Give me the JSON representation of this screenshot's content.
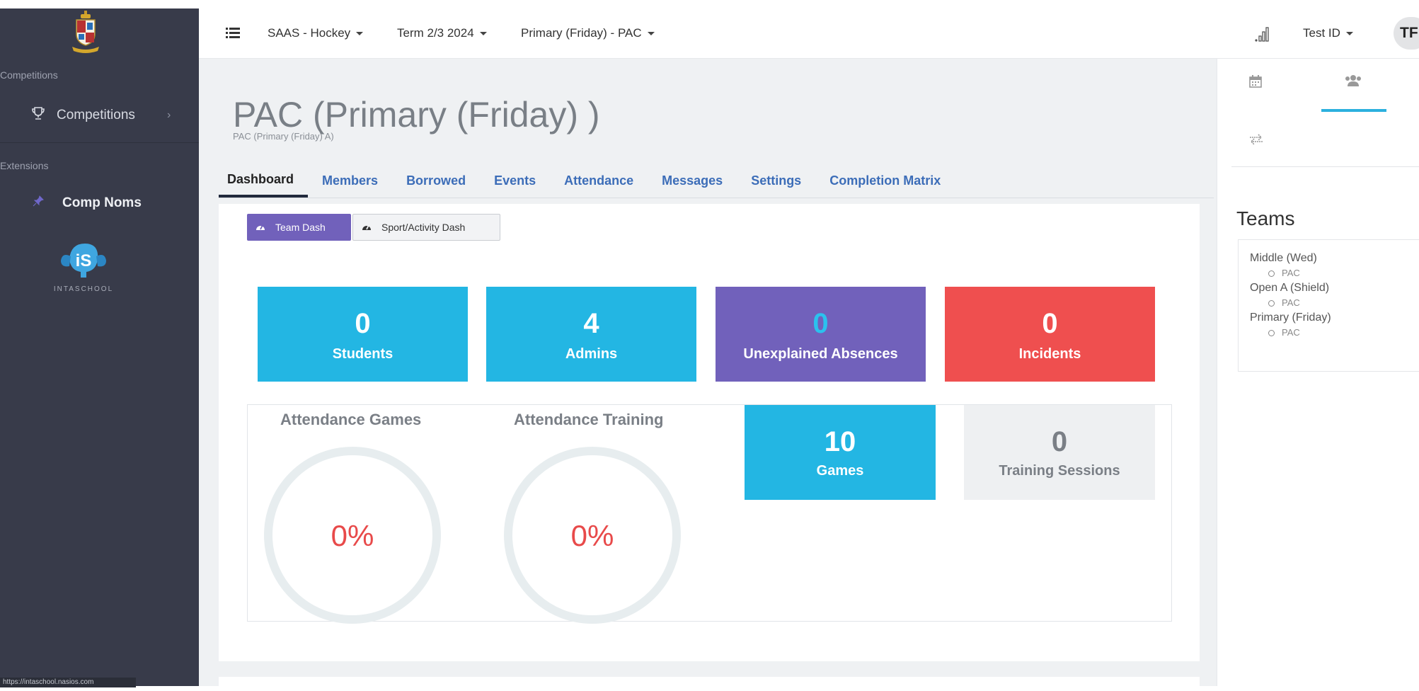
{
  "sidebar": {
    "sections": [
      {
        "label": "Competitions",
        "items": [
          {
            "label": "Competitions",
            "icon": "trophy-icon"
          }
        ]
      },
      {
        "label": "Extensions",
        "items": [
          {
            "label": "Comp Noms",
            "icon": "pin-icon"
          }
        ]
      }
    ],
    "logo_text": "INTASCHOOL",
    "status_url": "https://intaschool.nasios.com"
  },
  "topbar": {
    "nav": [
      {
        "label": "SAAS - Hockey"
      },
      {
        "label": "Term 2/3 2024"
      },
      {
        "label": "Primary (Friday) - PAC"
      }
    ],
    "user_label": "Test ID",
    "avatar_initials": "TF"
  },
  "page": {
    "title": "PAC (Primary (Friday) )",
    "subtitle": "PAC (Primary (Friday) A)"
  },
  "tabs": [
    {
      "label": "Dashboard",
      "active": true
    },
    {
      "label": "Members"
    },
    {
      "label": "Borrowed"
    },
    {
      "label": "Events"
    },
    {
      "label": "Attendance"
    },
    {
      "label": "Messages"
    },
    {
      "label": "Settings"
    },
    {
      "label": "Completion Matrix"
    }
  ],
  "dashboard": {
    "buttons": [
      {
        "label": "Team Dash",
        "icon": "dashboard-icon",
        "active": true
      },
      {
        "label": "Sport/Activity Dash",
        "icon": "dashboard-icon"
      }
    ],
    "stats": [
      {
        "value": "0",
        "label": "Students",
        "color": "#23b6e3",
        "num_color": "#ffffff"
      },
      {
        "value": "4",
        "label": "Admins",
        "color": "#23b6e3",
        "num_color": "#ffffff"
      },
      {
        "value": "0",
        "label": "Unexplained Absences",
        "color": "#7161bb",
        "num_color": "#2bc1ee"
      },
      {
        "value": "0",
        "label": "Incidents",
        "color": "#ef4f4f",
        "num_color": "#ffffff"
      }
    ],
    "attendance": [
      {
        "title": "Attendance Games",
        "value": "0%"
      },
      {
        "title": "Attendance Training",
        "value": "0%"
      }
    ],
    "counts": [
      {
        "value": "10",
        "label": "Games",
        "color": "#23b6e3",
        "text_color": "#ffffff"
      },
      {
        "value": "0",
        "label": "Training Sessions",
        "color": "#eef0f2",
        "text_color": "#7a7f86"
      }
    ]
  },
  "right_panel": {
    "tab_icons": [
      "calendar-icon",
      "users-icon",
      "transfer-icon"
    ],
    "teams_heading": "Teams",
    "teams": [
      {
        "name": "Middle (Wed)",
        "sub": "PAC"
      },
      {
        "name": "Open A (Shield)",
        "sub": "PAC"
      },
      {
        "name": "Primary (Friday)",
        "sub": "PAC"
      }
    ]
  },
  "colors": {
    "sidebar_bg": "#383b4a",
    "accent_purple": "#7161bb",
    "accent_blue": "#23b6e3",
    "accent_red": "#ef4f4f",
    "tab_link": "#3c6db8"
  }
}
